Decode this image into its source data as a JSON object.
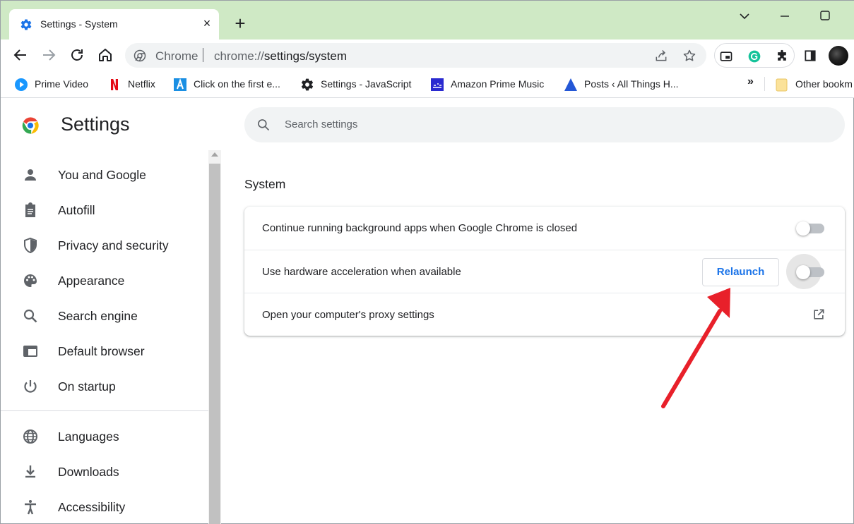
{
  "tab": {
    "title": "Settings - System",
    "close": "×",
    "new_tab": "+"
  },
  "omnibox": {
    "scheme": "Chrome",
    "url_prefix": "chrome://",
    "url_path": "settings/system"
  },
  "bookmarks": [
    {
      "label": "Prime Video",
      "icon": "prime-video-icon"
    },
    {
      "label": "Netflix",
      "icon": "netflix-icon"
    },
    {
      "label": "Click on the first e...",
      "icon": "a-letter-icon"
    },
    {
      "label": "Settings - JavaScript",
      "icon": "gear-icon"
    },
    {
      "label": "Amazon Prime Music",
      "icon": "prime-music-icon"
    },
    {
      "label": "Posts ‹ All Things H...",
      "icon": "triangle-icon"
    },
    {
      "label": "Other bookm",
      "icon": "folder-icon"
    }
  ],
  "bookmarks_more": "»",
  "settings": {
    "title": "Settings",
    "search_placeholder": "Search settings"
  },
  "sidebar": {
    "items": [
      {
        "label": "You and Google",
        "icon": "person-icon"
      },
      {
        "label": "Autofill",
        "icon": "clipboard-icon"
      },
      {
        "label": "Privacy and security",
        "icon": "shield-icon"
      },
      {
        "label": "Appearance",
        "icon": "palette-icon"
      },
      {
        "label": "Search engine",
        "icon": "search-icon"
      },
      {
        "label": "Default browser",
        "icon": "browser-window-icon"
      },
      {
        "label": "On startup",
        "icon": "power-icon"
      },
      {
        "label": "Languages",
        "icon": "globe-icon"
      },
      {
        "label": "Downloads",
        "icon": "download-icon"
      },
      {
        "label": "Accessibility",
        "icon": "accessibility-icon"
      }
    ]
  },
  "system": {
    "title": "System",
    "rows": [
      {
        "label": "Continue running background apps when Google Chrome is closed",
        "toggle": false
      },
      {
        "label": "Use hardware acceleration when available",
        "toggle": false,
        "button": "Relaunch"
      },
      {
        "label": "Open your computer's proxy settings",
        "icon": "open-external-icon"
      }
    ]
  },
  "colors": {
    "tabstrip": "#cfe9c5",
    "accent": "#1a73e8",
    "annotation_arrow": "#e8202a"
  }
}
